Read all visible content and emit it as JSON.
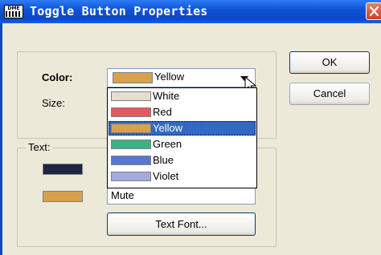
{
  "window": {
    "title": "Toggle Button Properties",
    "app_icon_text": "DME"
  },
  "buttons": {
    "ok": "OK",
    "cancel": "Cancel",
    "text_font": "Text Font..."
  },
  "labels": {
    "color": "Color:",
    "size": "Size:",
    "text_group": "Text:"
  },
  "color_combo": {
    "selected": "Yellow",
    "selected_color": "#D9A04C"
  },
  "color_options": [
    {
      "label": "White",
      "color": "#E6DCD0"
    },
    {
      "label": "Red",
      "color": "#E05A62"
    },
    {
      "label": "Yellow",
      "color": "#D9A04C",
      "selected": true
    },
    {
      "label": "Green",
      "color": "#3FAF86"
    },
    {
      "label": "Blue",
      "color": "#5577CC"
    },
    {
      "label": "Violet",
      "color": "#A6A9DE"
    }
  ],
  "text_fields": {
    "off_value": "",
    "on_value": "Mute",
    "off_color": "#1E2540",
    "on_color": "#D9A04C"
  },
  "colors": {
    "titlebar": "#0A48C8",
    "selection": "#316AC5",
    "dialog_bg": "#ECE9D8"
  }
}
